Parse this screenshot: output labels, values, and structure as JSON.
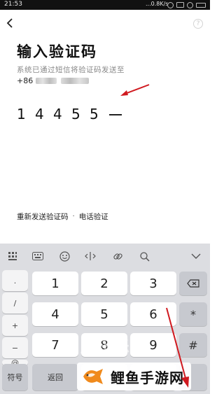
{
  "status_bar": {
    "time": "21:53",
    "speed": "...0.8K/s"
  },
  "nav": {
    "help_symbol": "?"
  },
  "title": "输入验证码",
  "description": "系统已通过短信将验证码发送至",
  "phone_prefix": "+86",
  "code_digits": [
    "1",
    "4",
    "4",
    "5",
    "5"
  ],
  "links": {
    "resend": "重新发送验证码",
    "separator": "·",
    "voice": "电话验证"
  },
  "keyboard": {
    "toolbar_icons": [
      "grid-icon",
      "keyboard-icon",
      "emoji-icon",
      "cursor-icon",
      "link-icon",
      "search-icon",
      "collapse-icon"
    ],
    "side_keys": [
      ".",
      "/",
      "+",
      "−",
      "@"
    ],
    "number_keys": [
      "1",
      "2",
      "3",
      "4",
      "5",
      "6",
      "7",
      "8",
      "9"
    ],
    "right_keys": [
      "⌫",
      "*",
      "#"
    ],
    "symbol_label": "符号",
    "back_label": "返回"
  },
  "watermarks": {
    "faint": "磨乐乐手",
    "brand": "鲤鱼手游网"
  },
  "colors": {
    "annotation_arrow": "#d0191f",
    "keyboard_bg": "#dcdde1"
  }
}
